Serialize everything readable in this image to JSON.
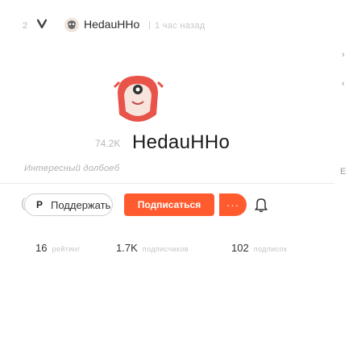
{
  "header": {
    "followers_count": "2",
    "channel_name": "HedauHHo",
    "time_ago": "1 час назад"
  },
  "right_edge": {
    "chevron_1": "›",
    "chevron_2": "‹",
    "letter": "E"
  },
  "profile": {
    "count": "74.2K",
    "name": "HedauHHo",
    "interesting_label": "Интересный долбоеб"
  },
  "actions": {
    "support_label": "Поддержать",
    "support_icon": "patreon-icon",
    "subscribe_label": "Подписаться",
    "more_label": "···",
    "bell_icon": "bell-icon"
  },
  "stats": {
    "posts_value": "16",
    "posts_label": "рейтинг",
    "subscribers_value": "1.7K",
    "subscribers_label": "подписчиков",
    "subscriptions_value": "102",
    "subscriptions_label": "подписок"
  },
  "colors": {
    "accent": "#ff5b2f",
    "avatar_bg": "#f3dcd0",
    "avatar_face": "#e8534a"
  }
}
